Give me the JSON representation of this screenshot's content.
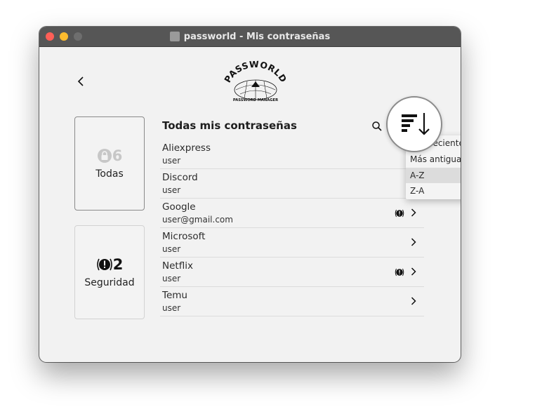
{
  "window": {
    "title": "passworld - Mis contraseñas"
  },
  "logo": {
    "name": "PASSWORLD",
    "tagline": "PASSWORD MANAGER"
  },
  "cards": {
    "todas": {
      "count": "6",
      "label": "Todas",
      "icon": "lock-icon"
    },
    "seguridad": {
      "count": "2",
      "label": "Seguridad",
      "icon": "warning-icon"
    }
  },
  "list": {
    "title": "Todas mis contraseñas",
    "items": [
      {
        "name": "Aliexpress",
        "user": "user",
        "warning": false,
        "chevron": false
      },
      {
        "name": "Discord",
        "user": "user",
        "warning": false,
        "chevron": false
      },
      {
        "name": "Google",
        "user": "user@gmail.com",
        "warning": true,
        "chevron": true
      },
      {
        "name": "Microsoft",
        "user": "user",
        "warning": false,
        "chevron": true
      },
      {
        "name": "Netflix",
        "user": "user",
        "warning": true,
        "chevron": true
      },
      {
        "name": "Temu",
        "user": "user",
        "warning": false,
        "chevron": true
      }
    ]
  },
  "sort_menu": {
    "options": [
      "Más reciente a más antigua",
      "Más antigua a más reciente",
      "A-Z",
      "Z-A"
    ],
    "highlighted": "A-Z"
  },
  "colors": {
    "titlebar": "#565656",
    "close": "#ff5f57",
    "minimize": "#febc2e"
  }
}
